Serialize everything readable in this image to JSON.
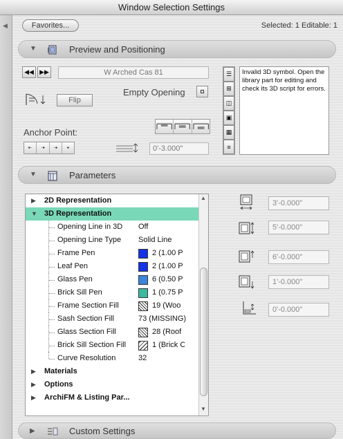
{
  "window": {
    "title": "Window Selection Settings"
  },
  "header": {
    "favorites_label": "Favorites...",
    "selection_status": "Selected: 1 Editable: 1"
  },
  "preview": {
    "title": "Preview and Positioning",
    "part_name": "W Arched Cas 81",
    "flip_label": "Flip",
    "empty_opening_label": "Empty Opening",
    "anchor_point_label": "Anchor Point:",
    "sill_value": "0'-3.000\"",
    "message": "Invalid 3D symbol. Open the library part for editing and check its 3D script for errors."
  },
  "parameters": {
    "title": "Parameters",
    "items": [
      {
        "label": "2D Representation",
        "kind": "group",
        "expanded": false
      },
      {
        "label": "3D Representation",
        "kind": "group",
        "expanded": true,
        "selected": true
      },
      {
        "label": "Opening Line in 3D",
        "kind": "param",
        "value": "Off"
      },
      {
        "label": "Opening Line Type",
        "kind": "param",
        "value": "Solid Line"
      },
      {
        "label": "Frame Pen",
        "kind": "param",
        "value": "2 (1.00 P",
        "color": "#1432e6"
      },
      {
        "label": "Leaf Pen",
        "kind": "param",
        "value": "2 (1.00 P",
        "color": "#1432e6"
      },
      {
        "label": "Glass Pen",
        "kind": "param",
        "value": "6 (0.50 P",
        "color": "#3a86d8"
      },
      {
        "label": "Brick Sill Pen",
        "kind": "param",
        "value": "1 (0.75 P",
        "color": "#3cb9a0"
      },
      {
        "label": "Frame Section Fill",
        "kind": "param",
        "value": "19 (Woo",
        "fill": "hatch-wood"
      },
      {
        "label": "Sash Section Fill",
        "kind": "param",
        "value": "73 (MISSING)"
      },
      {
        "label": "Glass Section Fill",
        "kind": "param",
        "value": "28 (Roof",
        "fill": "hatch-roof"
      },
      {
        "label": "Brick Sill Section Fill",
        "kind": "param",
        "value": "1 (Brick C",
        "fill": "hatch-brick"
      },
      {
        "label": "Curve Resolution",
        "kind": "param",
        "value": "32"
      },
      {
        "label": "Materials",
        "kind": "group",
        "expanded": false
      },
      {
        "label": "Options",
        "kind": "group",
        "expanded": false
      },
      {
        "label": "ArchiFM & Listing Par...",
        "kind": "group",
        "expanded": false
      }
    ],
    "dims": [
      "3'-0.000\"",
      "5'-0.000\"",
      "6'-0.000\"",
      "1'-0.000\"",
      "0'-0.000\""
    ]
  },
  "custom": {
    "title": "Custom Settings"
  }
}
